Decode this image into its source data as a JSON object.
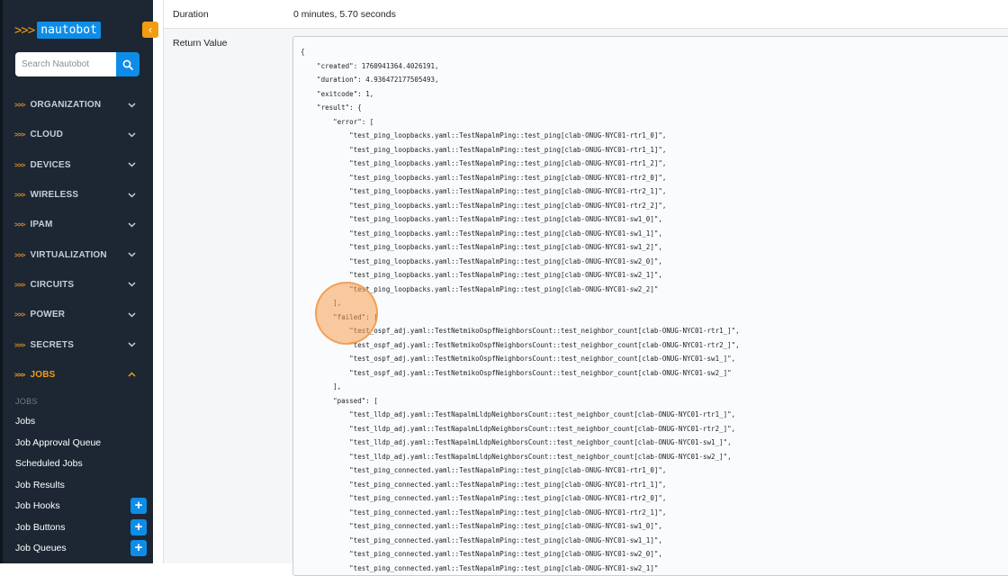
{
  "sidebar": {
    "logo_prefix": ">>>",
    "logo_text": "nautobot",
    "collapse_glyph": "‹",
    "search_placeholder": "Search Nautobot",
    "nav": [
      {
        "label": "ORGANIZATION"
      },
      {
        "label": "CLOUD"
      },
      {
        "label": "DEVICES"
      },
      {
        "label": "WIRELESS"
      },
      {
        "label": "IPAM"
      },
      {
        "label": "VIRTUALIZATION"
      },
      {
        "label": "CIRCUITS"
      },
      {
        "label": "POWER"
      },
      {
        "label": "SECRETS"
      },
      {
        "label": "JOBS",
        "active": true
      }
    ],
    "nav_prefix": ">>>",
    "jobs_section_header": "JOBS",
    "jobs_items": [
      {
        "label": "Jobs",
        "plus": false
      },
      {
        "label": "Job Approval Queue",
        "plus": false
      },
      {
        "label": "Scheduled Jobs",
        "plus": false
      },
      {
        "label": "Job Results",
        "plus": false
      },
      {
        "label": "Job Hooks",
        "plus": true
      },
      {
        "label": "Job Buttons",
        "plus": true
      },
      {
        "label": "Job Queues",
        "plus": true
      }
    ],
    "plus_glyph": "+"
  },
  "main": {
    "duration_label": "Duration",
    "duration_value": "0 minutes, 5.70 seconds",
    "return_label": "Return Value",
    "code_lines": [
      "{",
      "    \"created\": 1760941364.4026191,",
      "    \"duration\": 4.936472177505493,",
      "    \"exitcode\": 1,",
      "    \"result\": {",
      "        \"error\": [",
      "            \"test_ping_loopbacks.yaml::TestNapalmPing::test_ping[clab-ONUG-NYC01-rtr1_0]\",",
      "            \"test_ping_loopbacks.yaml::TestNapalmPing::test_ping[clab-ONUG-NYC01-rtr1_1]\",",
      "            \"test_ping_loopbacks.yaml::TestNapalmPing::test_ping[clab-ONUG-NYC01-rtr1_2]\",",
      "            \"test_ping_loopbacks.yaml::TestNapalmPing::test_ping[clab-ONUG-NYC01-rtr2_0]\",",
      "            \"test_ping_loopbacks.yaml::TestNapalmPing::test_ping[clab-ONUG-NYC01-rtr2_1]\",",
      "            \"test_ping_loopbacks.yaml::TestNapalmPing::test_ping[clab-ONUG-NYC01-rtr2_2]\",",
      "            \"test_ping_loopbacks.yaml::TestNapalmPing::test_ping[clab-ONUG-NYC01-sw1_0]\",",
      "            \"test_ping_loopbacks.yaml::TestNapalmPing::test_ping[clab-ONUG-NYC01-sw1_1]\",",
      "            \"test_ping_loopbacks.yaml::TestNapalmPing::test_ping[clab-ONUG-NYC01-sw1_2]\",",
      "            \"test_ping_loopbacks.yaml::TestNapalmPing::test_ping[clab-ONUG-NYC01-sw2_0]\",",
      "            \"test_ping_loopbacks.yaml::TestNapalmPing::test_ping[clab-ONUG-NYC01-sw2_1]\",",
      "            \"test_ping_loopbacks.yaml::TestNapalmPing::test_ping[clab-ONUG-NYC01-sw2_2]\"",
      "        ],",
      "        \"failed\": [",
      "            \"test_ospf_adj.yaml::TestNetmikoOspfNeighborsCount::test_neighbor_count[clab-ONUG-NYC01-rtr1_]\",",
      "            \"test_ospf_adj.yaml::TestNetmikoOspfNeighborsCount::test_neighbor_count[clab-ONUG-NYC01-rtr2_]\",",
      "            \"test_ospf_adj.yaml::TestNetmikoOspfNeighborsCount::test_neighbor_count[clab-ONUG-NYC01-sw1_]\",",
      "            \"test_ospf_adj.yaml::TestNetmikoOspfNeighborsCount::test_neighbor_count[clab-ONUG-NYC01-sw2_]\"",
      "        ],",
      "        \"passed\": [",
      "            \"test_lldp_adj.yaml::TestNapalmLldpNeighborsCount::test_neighbor_count[clab-ONUG-NYC01-rtr1_]\",",
      "            \"test_lldp_adj.yaml::TestNapalmLldpNeighborsCount::test_neighbor_count[clab-ONUG-NYC01-rtr2_]\",",
      "            \"test_lldp_adj.yaml::TestNapalmLldpNeighborsCount::test_neighbor_count[clab-ONUG-NYC01-sw1_]\",",
      "            \"test_lldp_adj.yaml::TestNapalmLldpNeighborsCount::test_neighbor_count[clab-ONUG-NYC01-sw2_]\",",
      "            \"test_ping_connected.yaml::TestNapalmPing::test_ping[clab-ONUG-NYC01-rtr1_0]\",",
      "            \"test_ping_connected.yaml::TestNapalmPing::test_ping[clab-ONUG-NYC01-rtr1_1]\",",
      "            \"test_ping_connected.yaml::TestNapalmPing::test_ping[clab-ONUG-NYC01-rtr2_0]\",",
      "            \"test_ping_connected.yaml::TestNapalmPing::test_ping[clab-ONUG-NYC01-rtr2_1]\",",
      "            \"test_ping_connected.yaml::TestNapalmPing::test_ping[clab-ONUG-NYC01-sw1_0]\",",
      "            \"test_ping_connected.yaml::TestNapalmPing::test_ping[clab-ONUG-NYC01-sw1_1]\",",
      "            \"test_ping_connected.yaml::TestNapalmPing::test_ping[clab-ONUG-NYC01-sw2_0]\",",
      "            \"test_ping_connected.yaml::TestNapalmPing::test_ping[clab-ONUG-NYC01-sw2_1]\""
    ]
  },
  "colors": {
    "sidebar_bg": "#1c2733",
    "accent_orange": "#f39c12",
    "accent_blue": "#0e8de8"
  }
}
